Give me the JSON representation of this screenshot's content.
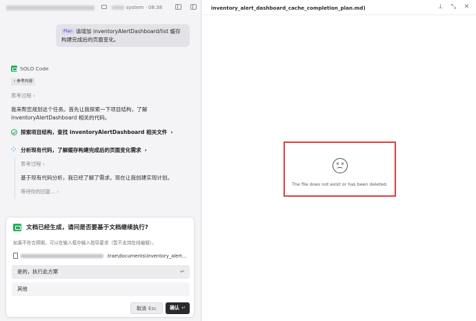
{
  "left_header": {
    "project_suffix": "system",
    "time": "08:38"
  },
  "chat": {
    "user_message": {
      "tag": "Plan",
      "text": "请增加 inventoryAlertDashboard/list 缓存构建完成后的页面变化。"
    },
    "agent_name": "SOLO Code",
    "reference_label": "参考内容",
    "thinking_label": "思考过程 ›",
    "intro_text": "我来帮您规划这个任务。首先让我探索一下项目结构，了解 inventoryAlertDashboard 相关的代码。",
    "step1": "探索项目结构，查找 inventoryAlertDashboard 相关文件",
    "step2": "分析现有代码，了解缓存构建完成后的页面变化需求",
    "step2_thinking_label": "思考过程 ›",
    "step2_text": "基于现有代码分析，我已经了解了需求。现在让我创建实现计划。",
    "waiting_text": "等待你的回复... ›"
  },
  "confirm_card": {
    "title": "文档已经生成，请问是否要基于文档继续执行?",
    "hint": "如果不符合预期，可以在输入框中输入指导要求（暂不支持在线编辑）。",
    "path_tail": ".trae\\documents\\inventory_alert...",
    "option_execute": "是的，执行此方案",
    "option_other": "其他",
    "enter_symbol": "↵",
    "cancel_label": "取消",
    "cancel_key": "Esc",
    "confirm_label": "确认",
    "confirm_key": "↵"
  },
  "file_panel": {
    "filename": "inventory_alert_dashboard_cache_completion_plan.md)",
    "error_message": "The file does not exist or has been deleted."
  },
  "colors": {
    "accent_green": "#1fae58",
    "highlight_red": "#e03a3a"
  }
}
